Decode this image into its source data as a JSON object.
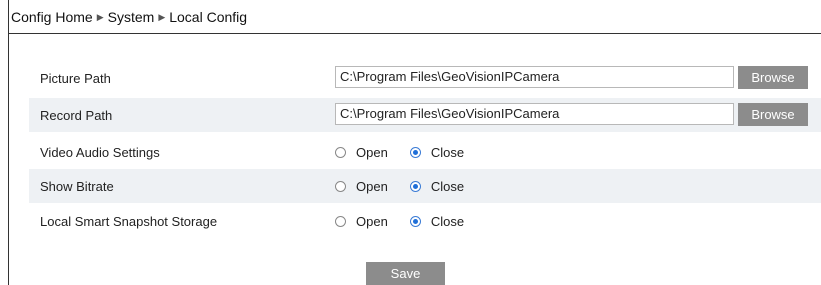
{
  "breadcrumb": {
    "items": [
      "Config Home",
      "System",
      "Local Config"
    ],
    "separator": "▶"
  },
  "settings": {
    "picture_path": {
      "label": "Picture Path",
      "value": "C:\\Program Files\\GeoVisionIPCamera",
      "button": "Browse"
    },
    "record_path": {
      "label": "Record Path",
      "value": "C:\\Program Files\\GeoVisionIPCamera",
      "button": "Browse"
    },
    "video_audio": {
      "label": "Video Audio Settings",
      "options": [
        "Open",
        "Close"
      ],
      "selected": "Close"
    },
    "show_bitrate": {
      "label": "Show Bitrate",
      "options": [
        "Open",
        "Close"
      ],
      "selected": "Close"
    },
    "smart_snapshot": {
      "label": "Local Smart Snapshot Storage",
      "options": [
        "Open",
        "Close"
      ],
      "selected": "Close"
    }
  },
  "save_label": "Save",
  "colors": {
    "button_bg": "#8c8c8c",
    "row_shade": "#eef1f4",
    "radio_accent": "#1f6fd8"
  }
}
